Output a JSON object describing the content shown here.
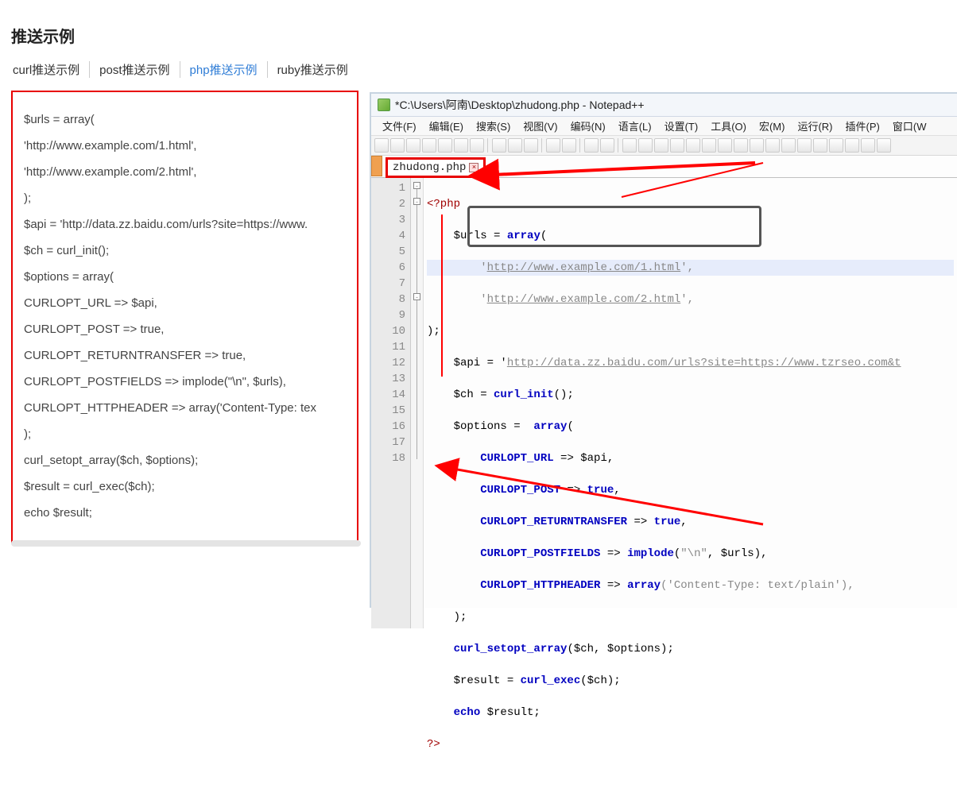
{
  "header": {
    "title": "推送示例"
  },
  "tabs": {
    "items": [
      {
        "label": "curl推送示例",
        "active": false
      },
      {
        "label": "post推送示例",
        "active": false
      },
      {
        "label": "php推送示例",
        "active": true
      },
      {
        "label": "ruby推送示例",
        "active": false
      }
    ]
  },
  "left_code": {
    "l1": "$urls = array(",
    "l2": "    'http://www.example.com/1.html',",
    "l3": "    'http://www.example.com/2.html',",
    "l4": ");",
    "l5": "$api = 'http://data.zz.baidu.com/urls?site=https://www.",
    "l6": "$ch = curl_init();",
    "l7": "$options =  array(",
    "l8": "    CURLOPT_URL => $api,",
    "l9": "    CURLOPT_POST => true,",
    "l10": "    CURLOPT_RETURNTRANSFER => true,",
    "l11": "    CURLOPT_POSTFIELDS => implode(\"\\n\", $urls),",
    "l12": "    CURLOPT_HTTPHEADER => array('Content-Type: tex",
    "l13": ");",
    "l14": "curl_setopt_array($ch, $options);",
    "l15": "$result = curl_exec($ch);",
    "l16": "echo $result;"
  },
  "notepad": {
    "title": "*C:\\Users\\阿南\\Desktop\\zhudong.php - Notepad++",
    "menus": [
      "文件(F)",
      "编辑(E)",
      "搜索(S)",
      "视图(V)",
      "编码(N)",
      "语言(L)",
      "设置(T)",
      "工具(O)",
      "宏(M)",
      "运行(R)",
      "插件(P)",
      "窗口(W"
    ],
    "tab_label": "zhudong.php",
    "gutter": [
      "1",
      "2",
      "3",
      "4",
      "5",
      "6",
      "7",
      "8",
      "9",
      "10",
      "11",
      "12",
      "13",
      "14",
      "15",
      "16",
      "17",
      "18"
    ],
    "code": {
      "php_open": "<?php",
      "l2a": "$urls",
      "l2b": " = ",
      "l2c": "array",
      "l2d": "(",
      "l3a": "        '",
      "l3b": "http://www.example.com/1.html",
      "l3c": "',",
      "l4a": "        '",
      "l4b": "http://www.example.com/2.html",
      "l4c": "',",
      "l5": ");",
      "l6a": "    $api = '",
      "l6b": "http://data.zz.baidu.com/urls?site=https://www.tzrseo.com&t",
      "l6c": "",
      "l7a": "    $ch = ",
      "l7b": "curl_init",
      "l7c": "();",
      "l8a": "    $options =  ",
      "l8b": "array",
      "l8c": "(",
      "l9a": "        ",
      "l9b": "CURLOPT_URL",
      "l9c": " => $api,",
      "l10a": "        ",
      "l10b": "CURLOPT_POST",
      "l10c": " => ",
      "l10d": "true",
      "l10e": ",",
      "l11a": "        ",
      "l11b": "CURLOPT_RETURNTRANSFER",
      "l11c": " => ",
      "l11d": "true",
      "l11e": ",",
      "l12a": "        ",
      "l12b": "CURLOPT_POSTFIELDS",
      "l12c": " => ",
      "l12d": "implode",
      "l12e": "(",
      "l12f": "\"\\n\"",
      "l12g": ", $urls),",
      "l13a": "        ",
      "l13b": "CURLOPT_HTTPHEADER",
      "l13c": " => ",
      "l13d": "array",
      "l13e": "('Content-Type: text/plain'),",
      "l14": "    );",
      "l15a": "    ",
      "l15b": "curl_setopt_array",
      "l15c": "($ch, $options);",
      "l16a": "    $result = ",
      "l16b": "curl_exec",
      "l16c": "($ch);",
      "l17a": "    ",
      "l17b": "echo",
      "l17c": " $result;",
      "php_close": "?>"
    }
  }
}
